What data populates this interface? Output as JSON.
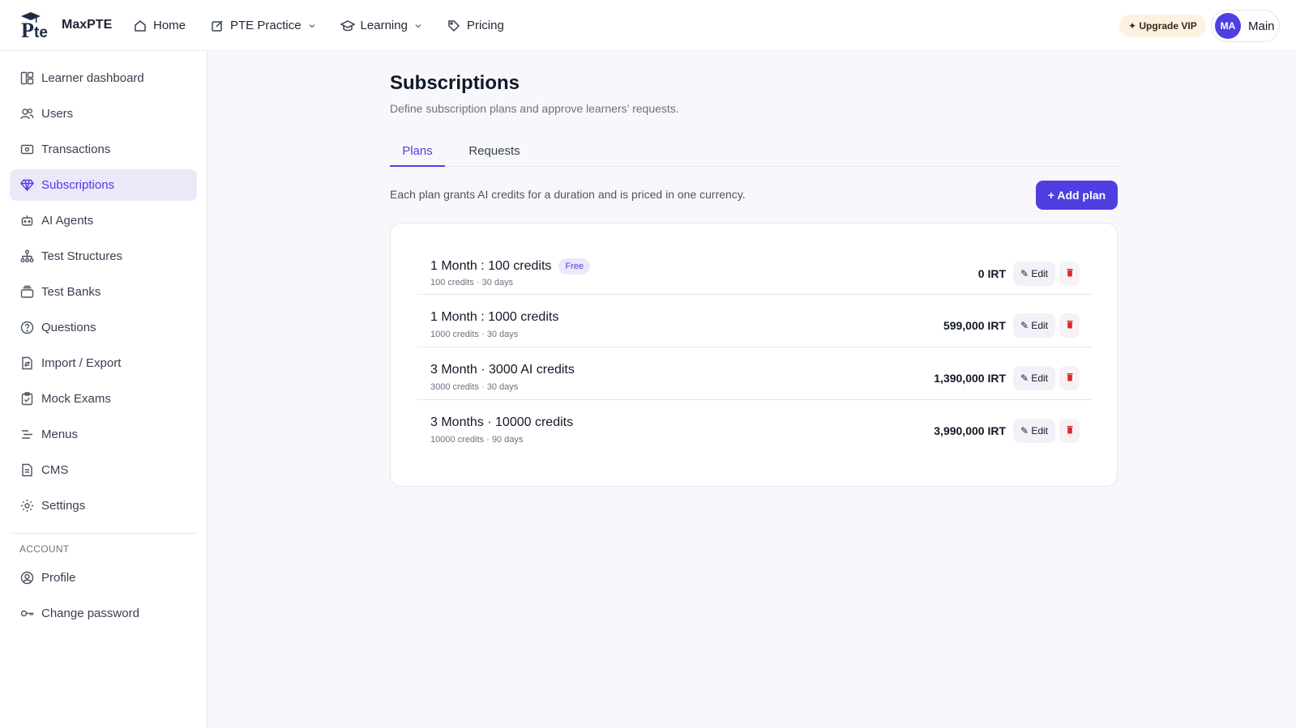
{
  "app": {
    "logo_text": "MaxPTE",
    "logo_mark": "Pte"
  },
  "topnav": {
    "items": [
      {
        "label": "Home",
        "icon": "home-icon"
      },
      {
        "label": "PTE Practice",
        "icon": "edit-icon",
        "dropdown": true
      },
      {
        "label": "Learning",
        "icon": "graduation-cap-icon",
        "dropdown": true
      },
      {
        "label": "Pricing",
        "icon": "tag-icon"
      }
    ],
    "upgrade_label": "✦ Upgrade VIP",
    "user_initials": "MA",
    "user_name": "Main"
  },
  "sidebar": {
    "items": [
      {
        "label": "Learner dashboard",
        "icon": "dashboard-icon"
      },
      {
        "label": "Users",
        "icon": "users-icon"
      },
      {
        "label": "Transactions",
        "icon": "cash-icon"
      },
      {
        "label": "Subscriptions",
        "icon": "diamond-icon",
        "active": true
      },
      {
        "label": "AI Agents",
        "icon": "robot-icon"
      },
      {
        "label": "Test Structures",
        "icon": "hierarchy-icon"
      },
      {
        "label": "Test Banks",
        "icon": "stack-icon"
      },
      {
        "label": "Questions",
        "icon": "question-icon"
      },
      {
        "label": "Import / Export",
        "icon": "file-transfer-icon"
      },
      {
        "label": "Mock Exams",
        "icon": "clipboard-icon"
      },
      {
        "label": "Menus",
        "icon": "menu-lines-icon"
      },
      {
        "label": "CMS",
        "icon": "document-icon"
      },
      {
        "label": "Settings",
        "icon": "gear-icon"
      }
    ],
    "account_heading": "ACCOUNT",
    "account_items": [
      {
        "label": "Profile",
        "icon": "profile-icon"
      },
      {
        "label": "Change password",
        "icon": "key-icon"
      }
    ]
  },
  "main": {
    "title": "Subscriptions",
    "subtitle": "Define subscription plans and approve learners’ requests.",
    "tabs": [
      {
        "label": "Plans",
        "active": true
      },
      {
        "label": "Requests",
        "active": false
      }
    ],
    "description": "Each plan grants AI credits for a duration and is priced in one currency.",
    "add_button": "+ Add plan",
    "edit_label": "✎ Edit",
    "plans": [
      {
        "name": "1 Month : 100 credits",
        "badge": "Free",
        "meta": "100 credits · 30 days",
        "price": "0 IRT"
      },
      {
        "name": "1 Month : 1000 credits",
        "badge": "",
        "meta": "1000 credits · 30 days",
        "price": "599,000 IRT"
      },
      {
        "name": "3 Month · 3000 AI credits",
        "badge": "",
        "meta": "3000 credits · 30 days",
        "price": "1,390,000 IRT"
      },
      {
        "name": "3 Months · 10000 credits",
        "badge": "",
        "meta": "10000 credits · 90 days",
        "price": "3,990,000 IRT"
      }
    ]
  },
  "colors": {
    "accent": "#4f3ee0",
    "accent_soft": "#ebe8fa",
    "danger": "#dc2626",
    "upgrade_bg": "#fdf2e2"
  }
}
